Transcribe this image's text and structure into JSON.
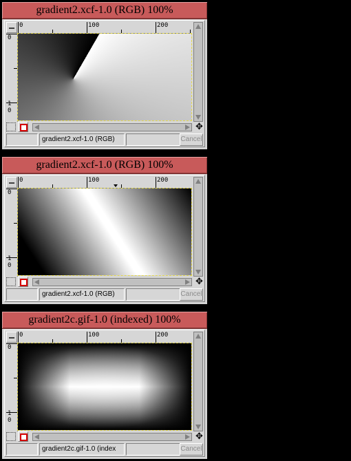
{
  "windows": [
    {
      "title": "gradient2.xcf-1.0 (RGB) 100%",
      "image": "conical-gradient",
      "status_name": "gradient2.xcf-1.0 (RGB)",
      "cancel_label": "Cancel",
      "hruler_labels": [
        "0",
        "100",
        "200"
      ],
      "vruler_labels": [
        "0",
        "1",
        "0"
      ]
    },
    {
      "title": "gradient2.xcf-1.0 (RGB) 100%",
      "image": "bilinear-diagonal-gradient",
      "status_name": "gradient2.xcf-1.0 (RGB)",
      "cancel_label": "Cancel",
      "hruler_labels": [
        "0",
        "100",
        "200"
      ],
      "vruler_labels": [
        "0",
        "1",
        "0"
      ]
    },
    {
      "title": "gradient2c.gif-1.0 (indexed) 100%",
      "image": "shaped-gradient",
      "status_name": "gradient2c.gif-1.0 (index",
      "cancel_label": "Cancel",
      "hruler_labels": [
        "0",
        "100",
        "200"
      ],
      "vruler_labels": [
        "0",
        "1",
        "0"
      ]
    }
  ],
  "icons": {
    "navigate": "move-crosshair-icon",
    "quickmask": "quick-mask-icon",
    "scroll_up": "arrow-up-icon",
    "scroll_down": "arrow-down-icon",
    "scroll_left": "arrow-left-icon",
    "scroll_right": "arrow-right-icon"
  },
  "colors": {
    "titlebar": "#c85a5a",
    "window_bg": "#d6d6d6",
    "selection_marching_ants": "#e5d84a",
    "quickmask_red": "#d40000",
    "disabled_text": "#8c8c8c"
  }
}
